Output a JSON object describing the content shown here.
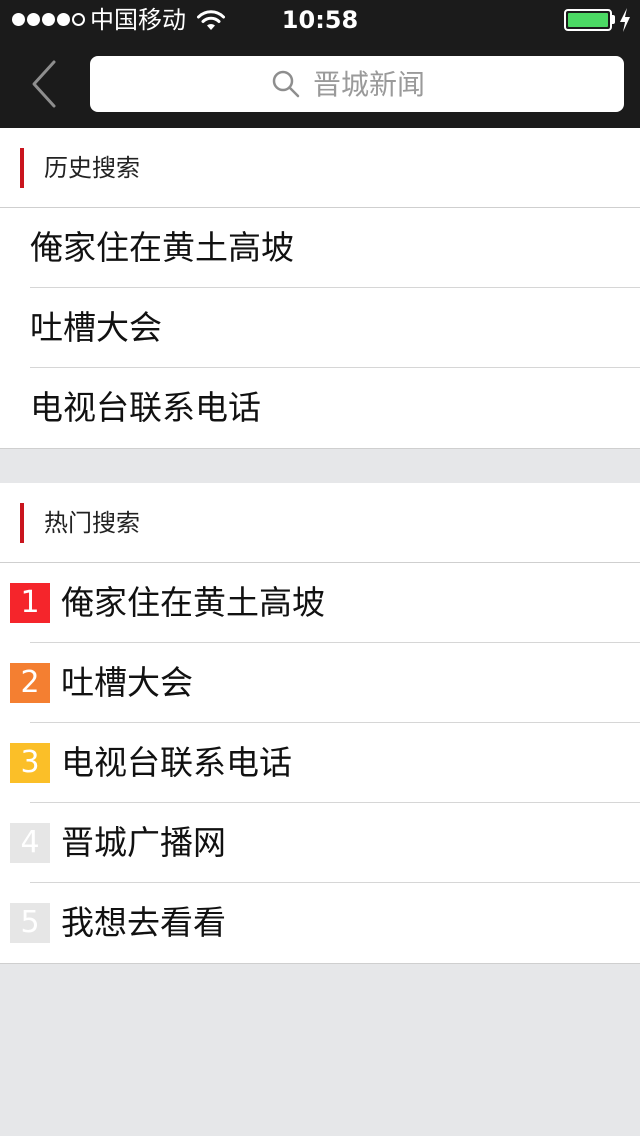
{
  "status_bar": {
    "carrier": "中国移动",
    "time": "10:58",
    "battery_level": 1.0,
    "colors": {
      "battery": "#4cd964"
    }
  },
  "nav": {
    "back_icon": "chevron-left-icon",
    "search": {
      "icon": "search-icon",
      "placeholder": "晋城新闻"
    }
  },
  "history": {
    "title": "历史搜索",
    "items": [
      {
        "label": "俺家住在黄土高坡"
      },
      {
        "label": "吐槽大会"
      },
      {
        "label": "电视台联系电话"
      }
    ]
  },
  "hot": {
    "title": "热门搜索",
    "items": [
      {
        "rank": "1",
        "label": "俺家住在黄土高坡",
        "color": "#f5252b"
      },
      {
        "rank": "2",
        "label": "吐槽大会",
        "color": "#f47f31"
      },
      {
        "rank": "3",
        "label": "电视台联系电话",
        "color": "#fbbf28"
      },
      {
        "rank": "4",
        "label": "晋城广播网",
        "color": "#e6e6e6"
      },
      {
        "rank": "5",
        "label": "我想去看看",
        "color": "#e6e6e6"
      }
    ]
  },
  "colors": {
    "accent": "#c9151e",
    "header_bg": "#1b1b1b",
    "page_bg": "#e6e7e9"
  }
}
